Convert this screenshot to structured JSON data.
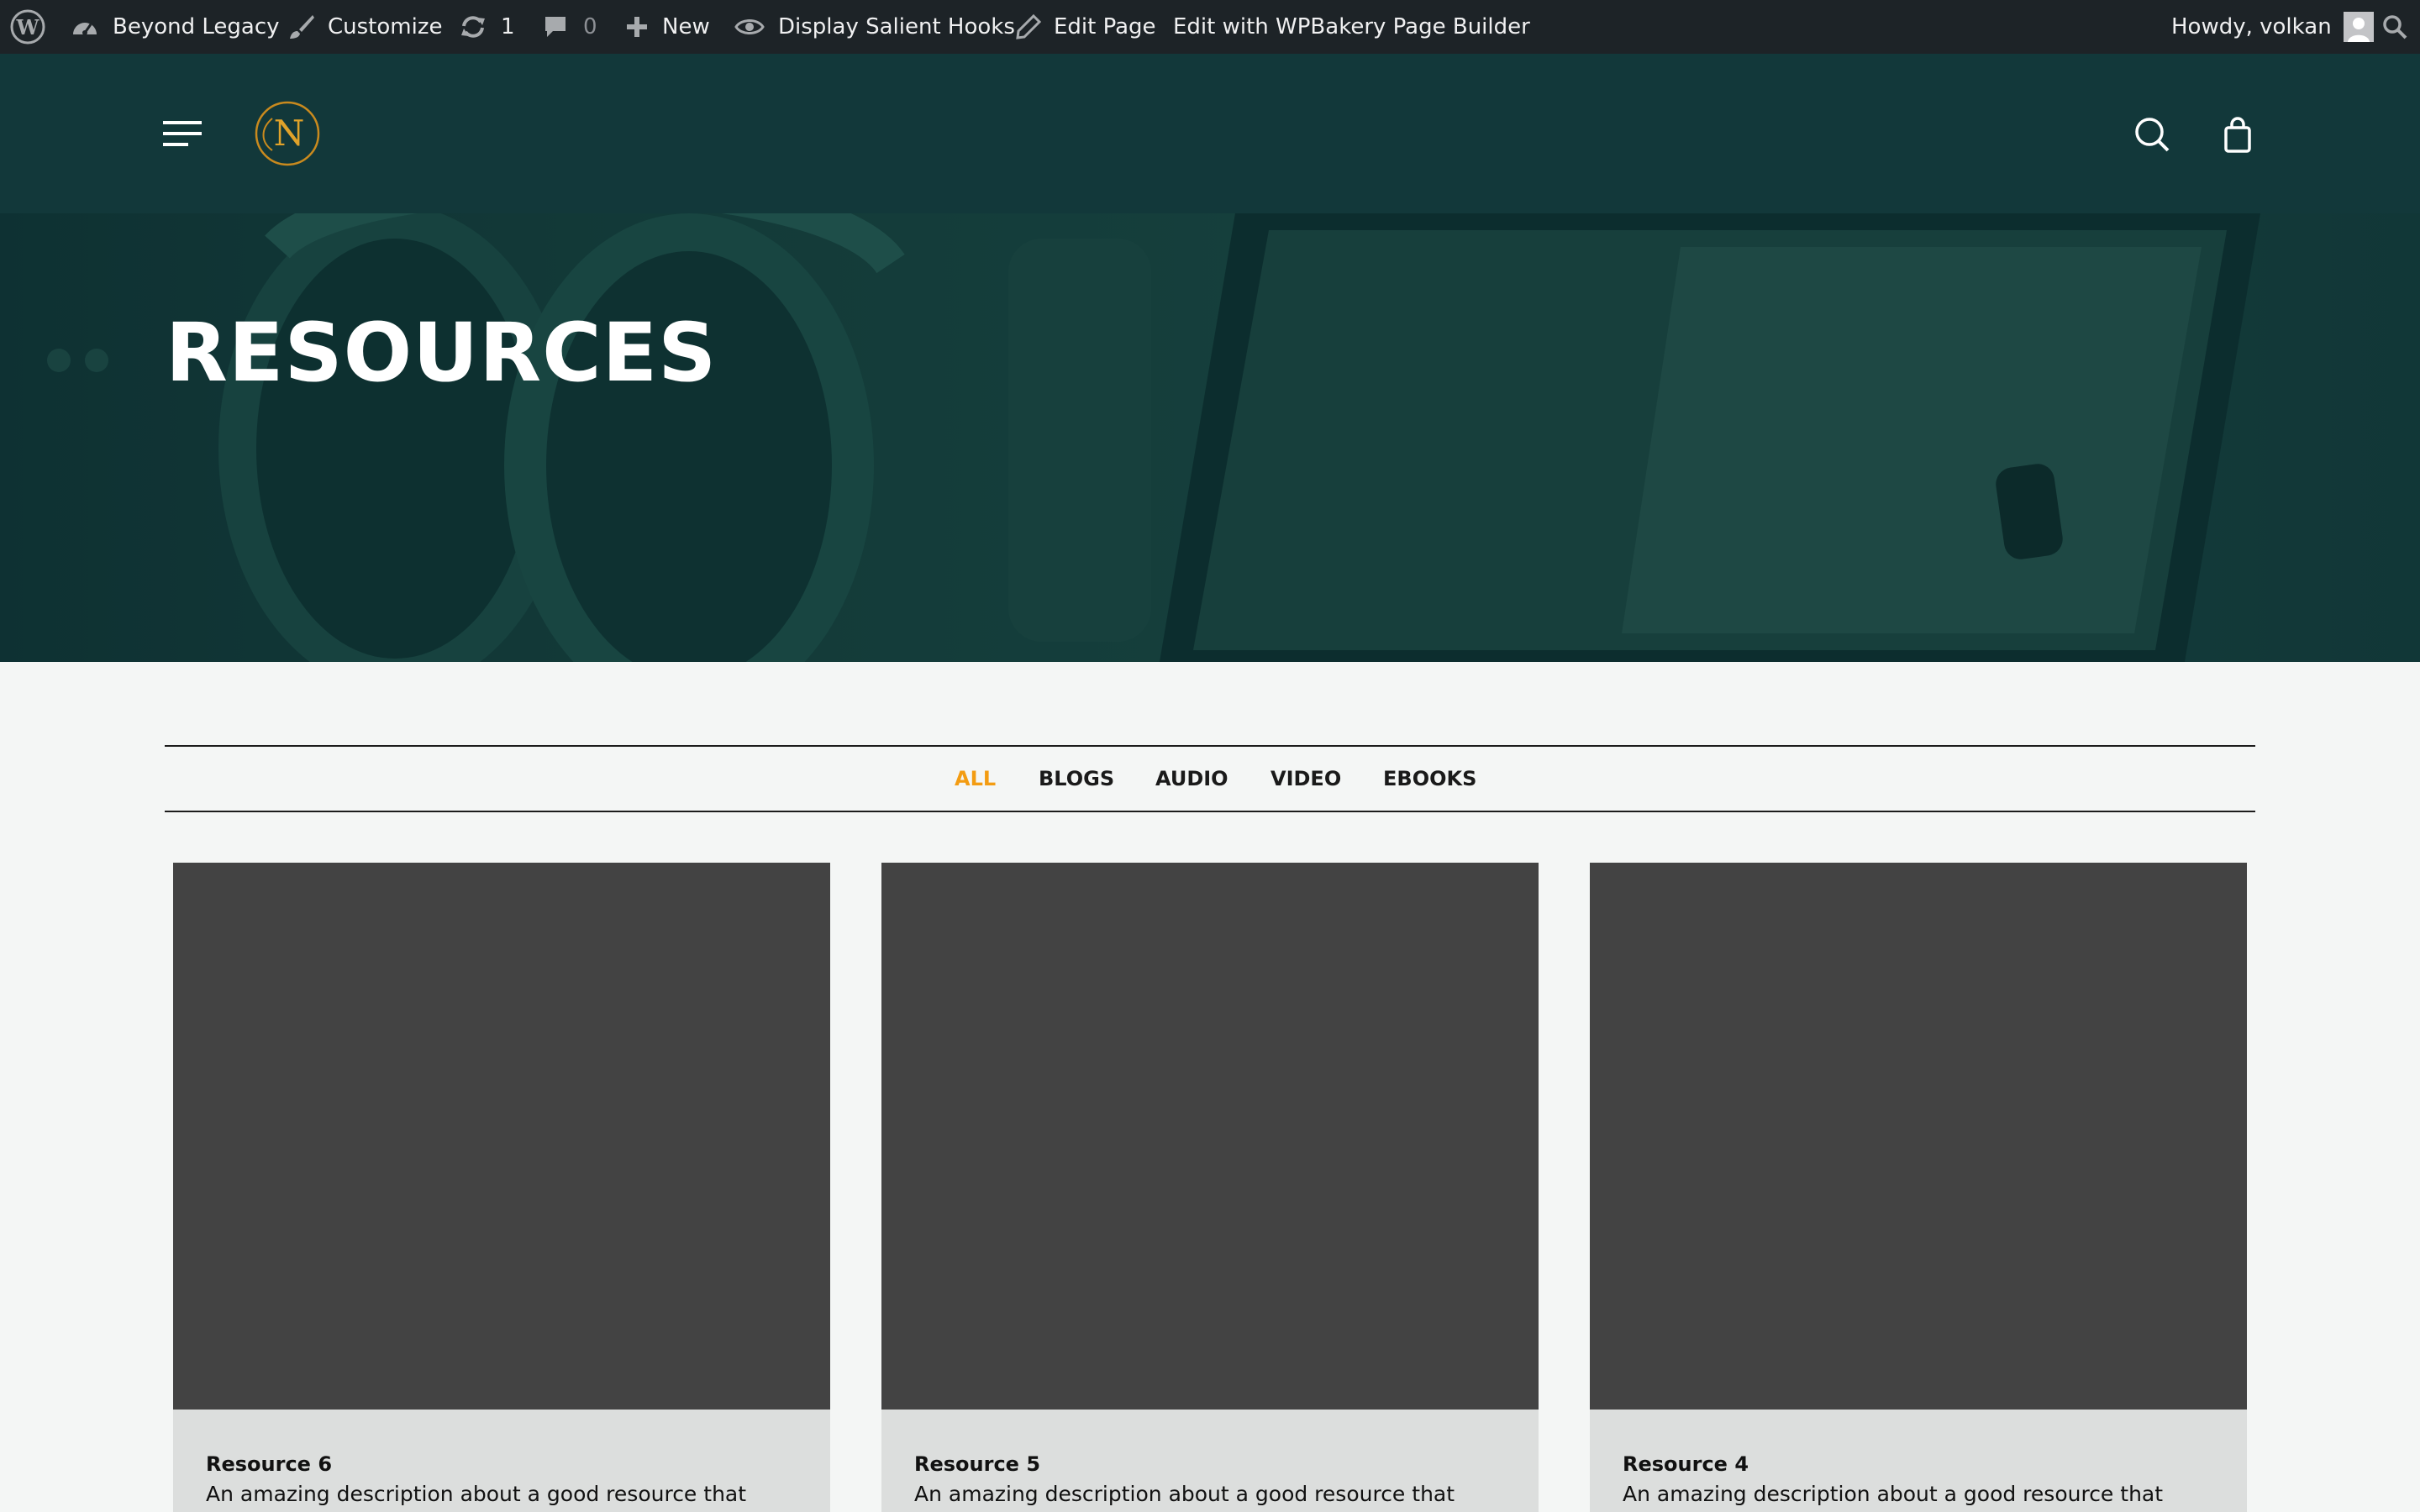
{
  "admin_bar": {
    "site_name": "Beyond Legacy",
    "customize": "Customize",
    "updates_count": "1",
    "comments_count": "0",
    "new": "New",
    "display_hooks": "Display Salient Hooks",
    "edit_page": "Edit Page",
    "edit_wpbakery": "Edit with WPBakery Page Builder",
    "howdy": "Howdy, volkan"
  },
  "header": {
    "logo_letter": "N",
    "icons": [
      "menu-icon",
      "search-icon",
      "cart-icon"
    ]
  },
  "hero": {
    "title": "RESOURCES"
  },
  "filters": {
    "items": [
      "ALL",
      "BLOGS",
      "AUDIO",
      "VIDEO",
      "EBOOKS"
    ],
    "active": "ALL"
  },
  "cards": [
    {
      "title": "Resource 6",
      "description": "An amazing description about a good resource that"
    },
    {
      "title": "Resource 5",
      "description": "An amazing description about a good resource that"
    },
    {
      "title": "Resource 4",
      "description": "An amazing description about a good resource that"
    }
  ],
  "colors": {
    "admin_bar_bg": "#1d2327",
    "header_bg": "#12383a",
    "accent": "#f39c12",
    "card_bg": "#dcdedd",
    "card_image_placeholder": "#434343"
  }
}
